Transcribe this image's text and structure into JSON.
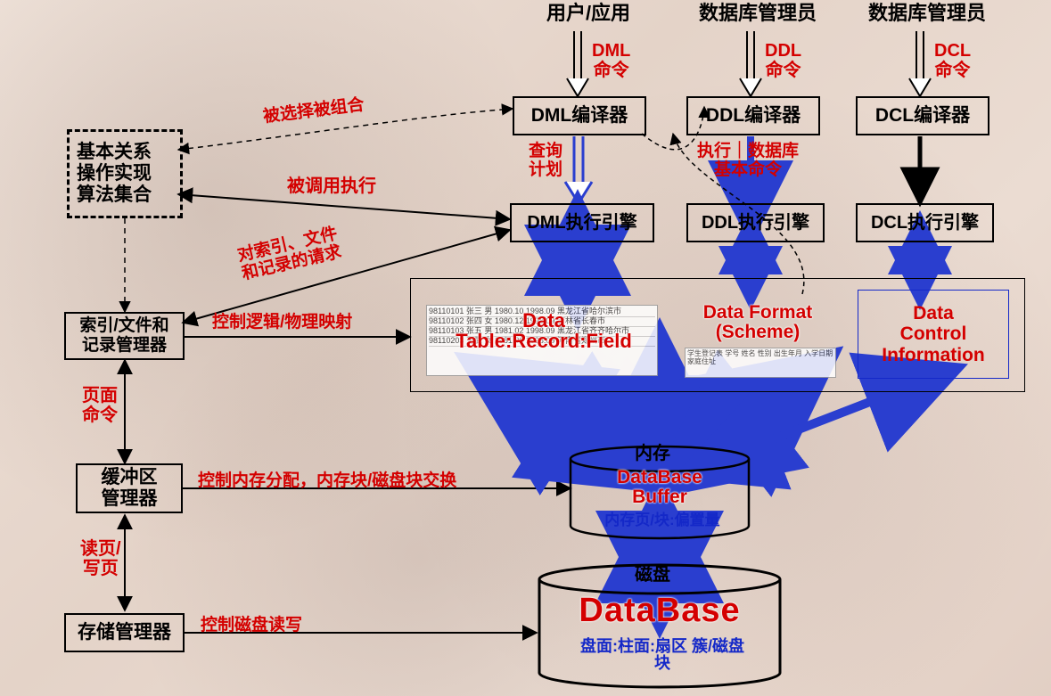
{
  "headers": {
    "user_app": "用户/应用",
    "dba1": "数据库管理员",
    "dba2": "数据库管理员"
  },
  "top_arrows": {
    "dml": "DML\n命令",
    "ddl": "DDL\n命令",
    "dcl": "DCL\n命令"
  },
  "compilers": {
    "dml": "DML编译器",
    "ddl": "DDL编译器",
    "dcl": "DCL编译器"
  },
  "engines": {
    "dml": "DML执行引擎",
    "ddl": "DDL执行引擎",
    "dcl": "DCL执行引擎"
  },
  "mid_labels": {
    "query_plan": "查询\n计划",
    "exec_basic": "执行｜数据库\n基本命令"
  },
  "left": {
    "algo": "基本关系\n操作实现\n算法集合",
    "index_mgr": "索引/文件和\n记录管理器",
    "buffer_mgr": "缓冲区\n管理器",
    "storage_mgr": "存储管理器"
  },
  "left_edge_labels": {
    "page_cmd": "页面\n命令",
    "rw_page": "读页/\n写页",
    "selected_combined": "被选择被组合",
    "called_exec": "被调用执行",
    "idx_file_req": "对索引、文件\n和记录的请求",
    "logic_phys_map": "控制逻辑/物理映射",
    "mem_alloc": "控制内存分配，内存块/磁盘块交换",
    "disk_rw": "控制磁盘读写"
  },
  "data_area": {
    "data_label": "Data\nTable:Record:Field",
    "format_label": "Data Format\n(Scheme)",
    "dci_label": "Data\nControl\nInformation"
  },
  "buffer": {
    "mem_title": "内存",
    "buf_name": "DataBase\nBuffer",
    "buf_sub": "内存页/块:偏置量"
  },
  "disk": {
    "disk_title": "磁盘",
    "db_name": "DataBase",
    "db_sub": "盘面:柱面:扇区\n簇/磁盘块"
  },
  "sample_rows": [
    "98110101  张三  男  1980.10  1998.09  黑龙江省哈尔滨市",
    "98110102  张四  女  1980.12  1998.09  吉林省长春市",
    "98110103  张五  男  1981.02  1998.09  黑龙江省齐齐哈尔市",
    "98110203  王武  女  1981.06  1998.09  河南省郑州市"
  ],
  "sample_header": "学生登记表\n学号  姓名  性别  出生年月  入学日期  家庭住址"
}
